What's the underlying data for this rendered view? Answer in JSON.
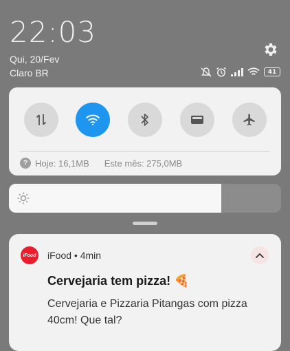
{
  "status": {
    "time": "22:03",
    "date": "Qui, 20/Fev",
    "carrier": "Claro BR",
    "battery": "41",
    "icons": [
      "settings-gear-icon",
      "mute-icon",
      "alarm-icon",
      "signal-icon",
      "wifi-icon",
      "battery-icon"
    ]
  },
  "quick_settings": {
    "toggles": [
      {
        "icon": "mobile-data-icon",
        "active": false
      },
      {
        "icon": "wifi-icon",
        "active": true
      },
      {
        "icon": "bluetooth-icon",
        "active": false
      },
      {
        "icon": "wallet-icon",
        "active": false
      },
      {
        "icon": "airplane-mode-icon",
        "active": false
      }
    ],
    "usage_today": "Hoje: 16,1MB",
    "usage_month": "Este mês: 275,0MB"
  },
  "brightness": {
    "level": 0.78,
    "icon": "sun-icon"
  },
  "notification": {
    "app_name": "iFood",
    "app_icon_text": "iFood",
    "separator": " • ",
    "time_ago": "4min",
    "title": "Cervejaria tem pizza! 🍕",
    "body": "Cervejaria e Pizzaria Pitangas com pizza 40cm! Que tal?"
  },
  "colors": {
    "accent": "#1e96ef",
    "ifood_red": "#ea1d2c",
    "background": "#7a7a7a"
  }
}
